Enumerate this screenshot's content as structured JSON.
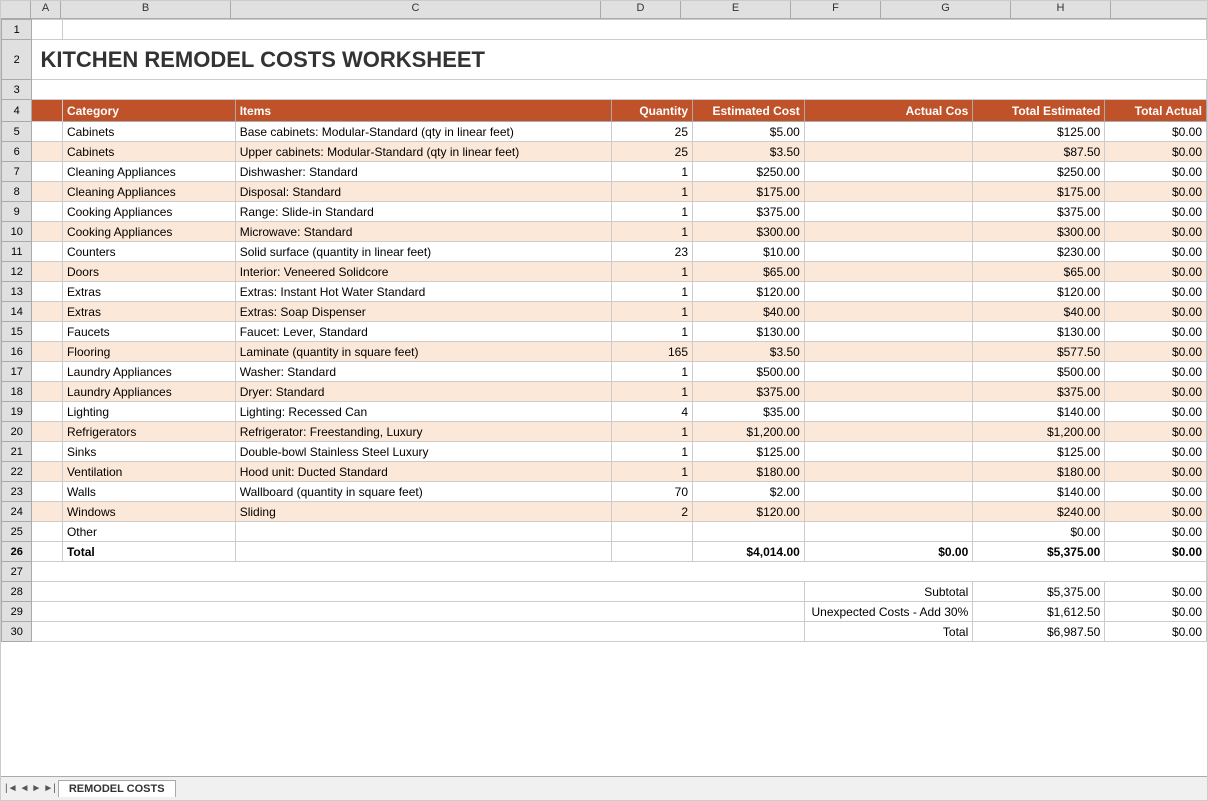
{
  "title": "KITCHEN REMODEL COSTS WORKSHEET",
  "sheet_name": "REMODEL COSTS",
  "columns": {
    "letters": [
      "",
      "A",
      "B",
      "C",
      "D",
      "E",
      "F",
      "G",
      "H"
    ],
    "widths": [
      30,
      30,
      170,
      370,
      80,
      110,
      90,
      130,
      100
    ]
  },
  "headers": {
    "category": "Category",
    "items": "Items",
    "quantity": "Quantity",
    "estimated_cost": "Estimated Cost",
    "actual_cost": "Actual Cos",
    "total_estimated": "Total Estimated",
    "total_actual": "Total Actual"
  },
  "rows": [
    {
      "num": 5,
      "category": "Cabinets",
      "items": "Base cabinets: Modular-Standard (qty in linear feet)",
      "quantity": "25",
      "estimated_cost": "$5.00",
      "actual_cost": "",
      "total_estimated": "$125.00",
      "total_actual": "$0.00",
      "striped": false
    },
    {
      "num": 6,
      "category": "Cabinets",
      "items": "Upper cabinets: Modular-Standard (qty in linear feet)",
      "quantity": "25",
      "estimated_cost": "$3.50",
      "actual_cost": "",
      "total_estimated": "$87.50",
      "total_actual": "$0.00",
      "striped": true
    },
    {
      "num": 7,
      "category": "Cleaning Appliances",
      "items": "Dishwasher: Standard",
      "quantity": "1",
      "estimated_cost": "$250.00",
      "actual_cost": "",
      "total_estimated": "$250.00",
      "total_actual": "$0.00",
      "striped": false
    },
    {
      "num": 8,
      "category": "Cleaning Appliances",
      "items": "Disposal: Standard",
      "quantity": "1",
      "estimated_cost": "$175.00",
      "actual_cost": "",
      "total_estimated": "$175.00",
      "total_actual": "$0.00",
      "striped": true
    },
    {
      "num": 9,
      "category": "Cooking Appliances",
      "items": "Range: Slide-in Standard",
      "quantity": "1",
      "estimated_cost": "$375.00",
      "actual_cost": "",
      "total_estimated": "$375.00",
      "total_actual": "$0.00",
      "striped": false
    },
    {
      "num": 10,
      "category": "Cooking Appliances",
      "items": "Microwave: Standard",
      "quantity": "1",
      "estimated_cost": "$300.00",
      "actual_cost": "",
      "total_estimated": "$300.00",
      "total_actual": "$0.00",
      "striped": true
    },
    {
      "num": 11,
      "category": "Counters",
      "items": "Solid surface (quantity in linear feet)",
      "quantity": "23",
      "estimated_cost": "$10.00",
      "actual_cost": "",
      "total_estimated": "$230.00",
      "total_actual": "$0.00",
      "striped": false
    },
    {
      "num": 12,
      "category": "Doors",
      "items": "Interior: Veneered Solidcore",
      "quantity": "1",
      "estimated_cost": "$65.00",
      "actual_cost": "",
      "total_estimated": "$65.00",
      "total_actual": "$0.00",
      "striped": true
    },
    {
      "num": 13,
      "category": "Extras",
      "items": "Extras: Instant Hot Water Standard",
      "quantity": "1",
      "estimated_cost": "$120.00",
      "actual_cost": "",
      "total_estimated": "$120.00",
      "total_actual": "$0.00",
      "striped": false
    },
    {
      "num": 14,
      "category": "Extras",
      "items": "Extras: Soap Dispenser",
      "quantity": "1",
      "estimated_cost": "$40.00",
      "actual_cost": "",
      "total_estimated": "$40.00",
      "total_actual": "$0.00",
      "striped": true
    },
    {
      "num": 15,
      "category": "Faucets",
      "items": "Faucet: Lever, Standard",
      "quantity": "1",
      "estimated_cost": "$130.00",
      "actual_cost": "",
      "total_estimated": "$130.00",
      "total_actual": "$0.00",
      "striped": false
    },
    {
      "num": 16,
      "category": "Flooring",
      "items": "Laminate (quantity in square feet)",
      "quantity": "165",
      "estimated_cost": "$3.50",
      "actual_cost": "",
      "total_estimated": "$577.50",
      "total_actual": "$0.00",
      "striped": true
    },
    {
      "num": 17,
      "category": "Laundry Appliances",
      "items": "Washer: Standard",
      "quantity": "1",
      "estimated_cost": "$500.00",
      "actual_cost": "",
      "total_estimated": "$500.00",
      "total_actual": "$0.00",
      "striped": false
    },
    {
      "num": 18,
      "category": "Laundry Appliances",
      "items": "Dryer: Standard",
      "quantity": "1",
      "estimated_cost": "$375.00",
      "actual_cost": "",
      "total_estimated": "$375.00",
      "total_actual": "$0.00",
      "striped": true
    },
    {
      "num": 19,
      "category": "Lighting",
      "items": "Lighting: Recessed Can",
      "quantity": "4",
      "estimated_cost": "$35.00",
      "actual_cost": "",
      "total_estimated": "$140.00",
      "total_actual": "$0.00",
      "striped": false
    },
    {
      "num": 20,
      "category": "Refrigerators",
      "items": "Refrigerator: Freestanding, Luxury",
      "quantity": "1",
      "estimated_cost": "$1,200.00",
      "actual_cost": "",
      "total_estimated": "$1,200.00",
      "total_actual": "$0.00",
      "striped": true
    },
    {
      "num": 21,
      "category": "Sinks",
      "items": "Double-bowl Stainless Steel Luxury",
      "quantity": "1",
      "estimated_cost": "$125.00",
      "actual_cost": "",
      "total_estimated": "$125.00",
      "total_actual": "$0.00",
      "striped": false
    },
    {
      "num": 22,
      "category": "Ventilation",
      "items": "Hood unit: Ducted Standard",
      "quantity": "1",
      "estimated_cost": "$180.00",
      "actual_cost": "",
      "total_estimated": "$180.00",
      "total_actual": "$0.00",
      "striped": true
    },
    {
      "num": 23,
      "category": "Walls",
      "items": "Wallboard (quantity in square feet)",
      "quantity": "70",
      "estimated_cost": "$2.00",
      "actual_cost": "",
      "total_estimated": "$140.00",
      "total_actual": "$0.00",
      "striped": false
    },
    {
      "num": 24,
      "category": "Windows",
      "items": "Sliding",
      "quantity": "2",
      "estimated_cost": "$120.00",
      "actual_cost": "",
      "total_estimated": "$240.00",
      "total_actual": "$0.00",
      "striped": true
    },
    {
      "num": 25,
      "category": "Other",
      "items": "",
      "quantity": "",
      "estimated_cost": "",
      "actual_cost": "",
      "total_estimated": "$0.00",
      "total_actual": "$0.00",
      "striped": false
    }
  ],
  "total_row": {
    "num": 26,
    "label": "Total",
    "estimated_cost": "$4,014.00",
    "actual_cost": "$0.00",
    "total_estimated": "$5,375.00",
    "total_actual": "$0.00"
  },
  "summary": {
    "subtotal_label": "Subtotal",
    "subtotal_estimated": "$5,375.00",
    "subtotal_actual": "$0.00",
    "unexpected_label": "Unexpected Costs - Add 30%",
    "unexpected_estimated": "$1,612.50",
    "unexpected_actual": "$0.00",
    "total_label": "Total",
    "total_estimated": "$6,987.50",
    "total_actual": "$0.00"
  },
  "row_numbers": [
    1,
    2,
    3,
    4,
    5,
    6,
    7,
    8,
    9,
    10,
    11,
    12,
    13,
    14,
    15,
    16,
    17,
    18,
    19,
    20,
    21,
    22,
    23,
    24,
    25,
    26,
    27,
    28,
    29,
    30
  ]
}
